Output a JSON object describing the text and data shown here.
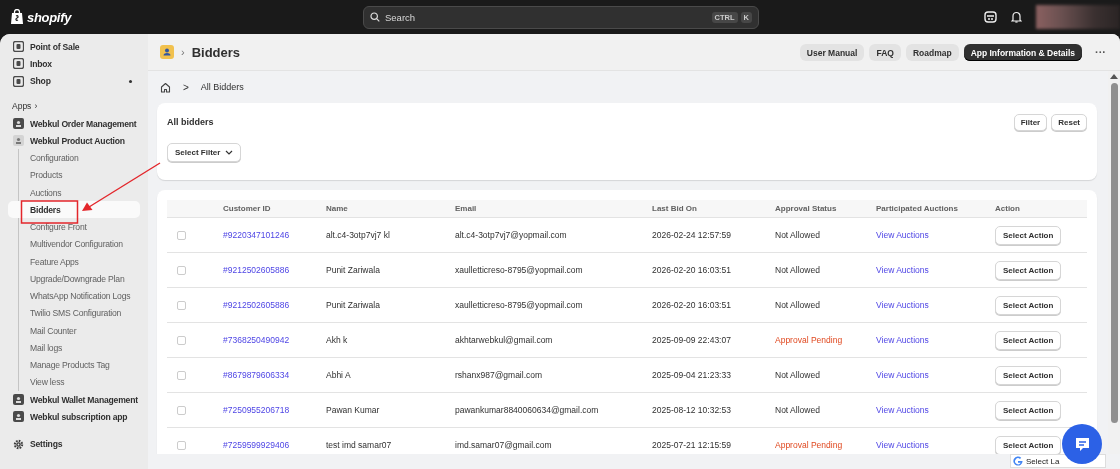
{
  "topbar": {
    "logo": "shopify",
    "search": {
      "placeholder": "Search"
    },
    "shortcut": [
      "CTRL",
      "K"
    ]
  },
  "sidebar": {
    "nav": [
      {
        "label": "Point of Sale",
        "selected": false
      },
      {
        "label": "Inbox",
        "selected": false
      },
      {
        "label": "Shop",
        "selected": false
      }
    ],
    "apps_label": "Apps",
    "apps_chevron": "›",
    "apps": [
      {
        "label": "Webkul Order Management",
        "expanded": false
      },
      {
        "label": "Webkul Product Auction",
        "expanded": true,
        "children": [
          {
            "label": "Configuration",
            "selected": false
          },
          {
            "label": "Products",
            "selected": false
          },
          {
            "label": "Auctions",
            "selected": false
          },
          {
            "label": "Bidders",
            "selected": true
          },
          {
            "label": "Configure Front",
            "selected": false
          },
          {
            "label": "Multivendor Configuration",
            "selected": false
          },
          {
            "label": "Feature Apps",
            "selected": false
          },
          {
            "label": "Upgrade/Downgrade Plan",
            "selected": false
          },
          {
            "label": "WhatsApp Notification Logs",
            "selected": false
          },
          {
            "label": "Twilio SMS Configuration",
            "selected": false
          },
          {
            "label": "Mail Counter",
            "selected": false
          },
          {
            "label": "Mail logs",
            "selected": false
          },
          {
            "label": "Manage Products Tag",
            "selected": false
          },
          {
            "label": "View less",
            "selected": false
          }
        ]
      },
      {
        "label": "Webkul Wallet Management",
        "expanded": false
      },
      {
        "label": "Webkul subscription app",
        "expanded": false
      }
    ],
    "settings": "Settings"
  },
  "header": {
    "separator": "›",
    "title": "Bidders",
    "buttons": [
      {
        "label": "User Manual",
        "primary": false
      },
      {
        "label": "FAQ",
        "primary": false
      },
      {
        "label": "Roadmap",
        "primary": false
      },
      {
        "label": "App Information & Details",
        "primary": true
      }
    ],
    "more": "···"
  },
  "breadcrumb": {
    "separator": ">",
    "current": "All Bidders"
  },
  "filter_card": {
    "title": "All bidders",
    "select": "Select Filter",
    "buttons": [
      "Filter",
      "Reset"
    ]
  },
  "table": {
    "columns": [
      "Customer ID",
      "Name",
      "Email",
      "Last Bid On",
      "Approval Status",
      "Participated Auctions",
      "Action"
    ],
    "rows": [
      {
        "checked": false,
        "id": "#9220347101246",
        "name": "alt.c4-3otp7vj7 kl",
        "email": "alt.c4-3otp7vj7@yopmail.com",
        "last_bid": "2026-02-24 12:57:59",
        "status": "Not Allowed",
        "pending": false,
        "link": "View Auctions",
        "action": "Select Action"
      },
      {
        "checked": false,
        "id": "#9212502605886",
        "name": "Punit Zariwala",
        "email": "xaulletticreso-8795@yopmail.com",
        "last_bid": "2026-02-20 16:03:51",
        "status": "Not Allowed",
        "pending": false,
        "link": "View Auctions",
        "action": "Select Action"
      },
      {
        "checked": false,
        "id": "#9212502605886",
        "name": "Punit Zariwala",
        "email": "xaulletticreso-8795@yopmail.com",
        "last_bid": "2026-02-20 16:03:51",
        "status": "Not Allowed",
        "pending": false,
        "link": "View Auctions",
        "action": "Select Action"
      },
      {
        "checked": false,
        "id": "#7368250490942",
        "name": "Akh k",
        "email": "akhtarwebkul@gmail.com",
        "last_bid": "2025-09-09 22:43:07",
        "status": "Approval Pending",
        "pending": true,
        "link": "View Auctions",
        "action": "Select Action"
      },
      {
        "checked": false,
        "id": "#8679879606334",
        "name": "Abhi A",
        "email": "rshanx987@gmail.com",
        "last_bid": "2025-09-04 21:23:33",
        "status": "Not Allowed",
        "pending": false,
        "link": "View Auctions",
        "action": "Select Action"
      },
      {
        "checked": false,
        "id": "#7250955206718",
        "name": "Pawan Kumar",
        "email": "pawankumar8840060634@gmail.com",
        "last_bid": "2025-08-12 10:32:53",
        "status": "Not Allowed",
        "pending": false,
        "link": "View Auctions",
        "action": "Select Action"
      },
      {
        "checked": false,
        "id": "#7259599929406",
        "name": "test imd samar07",
        "email": "imd.samar07@gmail.com",
        "last_bid": "2025-07-21 12:15:59",
        "status": "Approval Pending",
        "pending": true,
        "link": "View Auctions",
        "action": "Select Action"
      }
    ]
  },
  "translate": {
    "label": "Select La"
  }
}
